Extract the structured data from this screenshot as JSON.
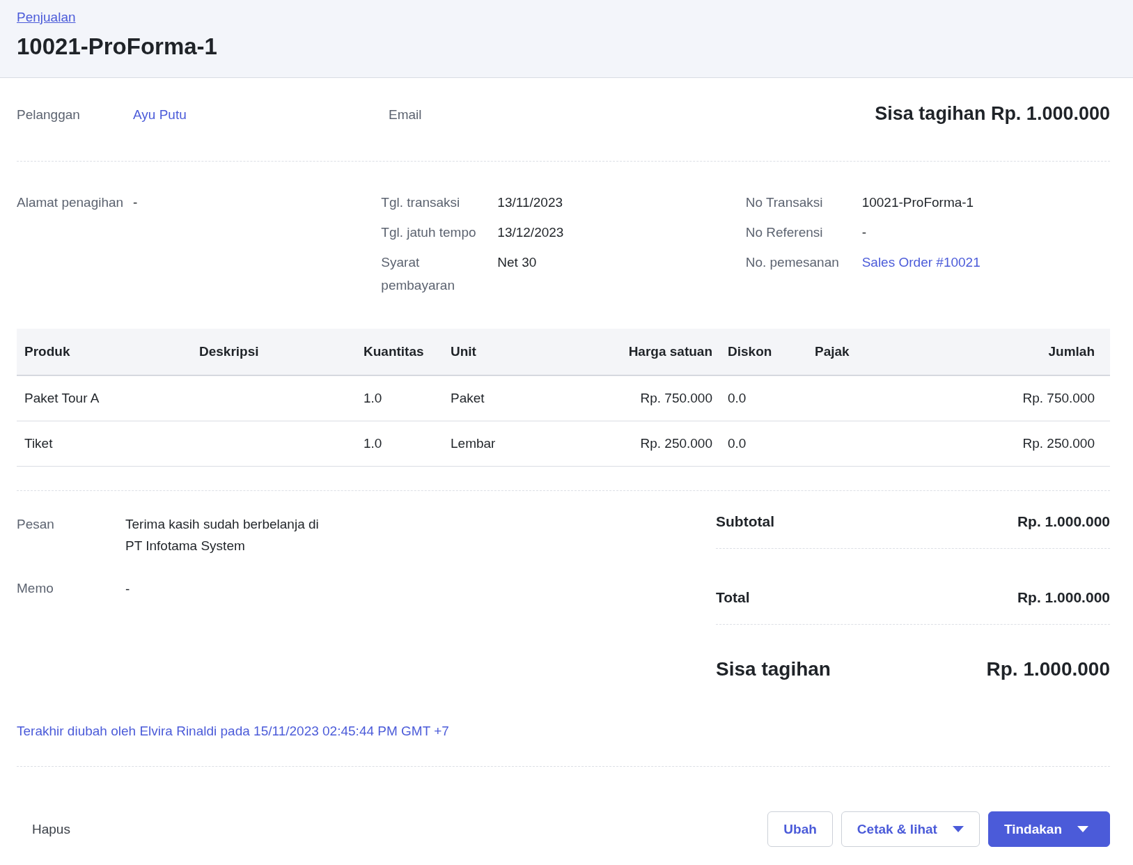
{
  "breadcrumb": "Penjualan",
  "title": "10021-ProForma-1",
  "customer": {
    "label": "Pelanggan",
    "value": "Ayu Putu"
  },
  "email": {
    "label": "Email"
  },
  "balance_heading": "Sisa tagihan Rp. 1.000.000",
  "billing_address": {
    "label": "Alamat penagihan",
    "value": "-"
  },
  "details_middle": [
    {
      "label": "Tgl. transaksi",
      "value": "13/11/2023"
    },
    {
      "label": "Tgl. jatuh tempo",
      "value": "13/12/2023"
    },
    {
      "label": "Syarat pembayaran",
      "value": "Net 30"
    }
  ],
  "details_right": [
    {
      "label": "No Transaksi",
      "value": "10021-ProForma-1",
      "kind": "text"
    },
    {
      "label": "No Referensi",
      "value": "-",
      "kind": "text"
    },
    {
      "label": "No. pemesanan",
      "value": "Sales Order #10021",
      "kind": "link"
    }
  ],
  "table": {
    "columns": [
      "Produk",
      "Deskripsi",
      "Kuantitas",
      "Unit",
      "Harga satuan",
      "Diskon",
      "Pajak",
      "Jumlah"
    ],
    "rows": [
      {
        "cells": [
          "Paket Tour A",
          "",
          "1.0",
          "Paket",
          "Rp. 750.000",
          "0.0",
          "",
          "Rp. 750.000"
        ]
      },
      {
        "cells": [
          "Tiket",
          "",
          "1.0",
          "Lembar",
          "Rp. 250.000",
          "0.0",
          "",
          "Rp. 250.000"
        ]
      }
    ]
  },
  "message": {
    "label": "Pesan",
    "value": "Terima kasih sudah berbelanja di PT Infotama System"
  },
  "memo": {
    "label": "Memo",
    "value": "-"
  },
  "totals": [
    {
      "label": "Subtotal",
      "value": "Rp. 1.000.000",
      "kind": "normal"
    },
    {
      "label": "Total",
      "value": "Rp. 1.000.000",
      "kind": "normal"
    },
    {
      "label": "Sisa tagihan",
      "value": "Rp. 1.000.000",
      "kind": "grand"
    }
  ],
  "last_modified": "Terakhir diubah oleh Elvira Rinaldi pada 15/11/2023 02:45:44 PM GMT +7",
  "delete_label": "Hapus",
  "buttons": [
    {
      "label": "Ubah",
      "kind": "outline"
    },
    {
      "label": "Cetak & lihat",
      "kind": "outline-menu"
    },
    {
      "label": "Tindakan",
      "kind": "primary-menu"
    }
  ]
}
